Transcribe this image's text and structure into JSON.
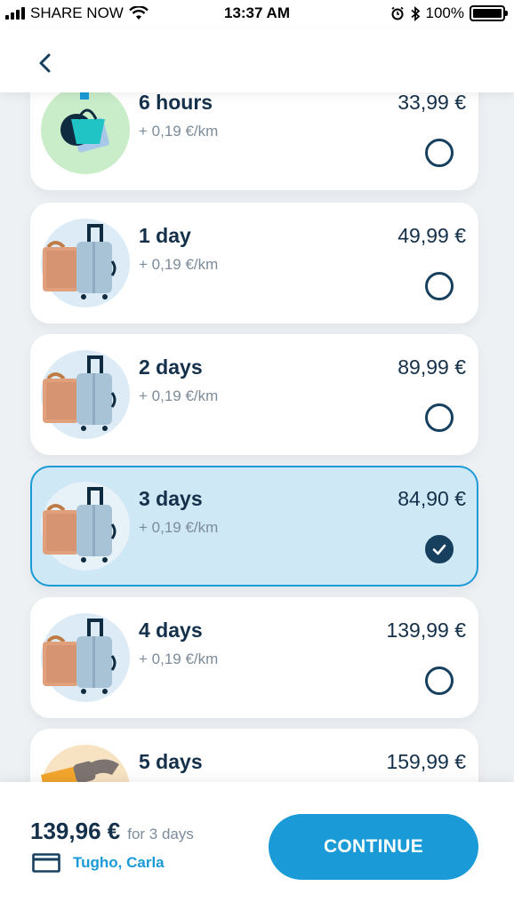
{
  "status_bar": {
    "carrier": "SHARE NOW",
    "time": "13:37 AM",
    "battery": "100%",
    "icons": [
      "signal-icon",
      "wifi-icon",
      "alarm-icon",
      "bluetooth-icon",
      "battery-icon"
    ]
  },
  "header": {
    "back_icon": "chevron-left-icon"
  },
  "options": [
    {
      "name": "6 hours",
      "rate": "+ 0,19 €/km",
      "price": "33,99 €",
      "selected": false,
      "illustration": "shopping-bag-icon"
    },
    {
      "name": "1 day",
      "rate": "+ 0,19 €/km",
      "price": "49,99 €",
      "selected": false,
      "illustration": "luggage-icon"
    },
    {
      "name": "2 days",
      "rate": "+ 0,19 €/km",
      "price": "89,99 €",
      "selected": false,
      "illustration": "luggage-icon"
    },
    {
      "name": "3 days",
      "rate": "+ 0,19 €/km",
      "price": "84,90 €",
      "selected": true,
      "illustration": "luggage-icon"
    },
    {
      "name": "4 days",
      "rate": "+ 0,19 €/km",
      "price": "139,99 €",
      "selected": false,
      "illustration": "luggage-icon"
    },
    {
      "name": "5 days",
      "rate": "",
      "price": "159,99 €",
      "selected": false,
      "illustration": "hand-watch-icon"
    }
  ],
  "footer": {
    "total": "139,96 €",
    "period": "for 3 days",
    "payer": "Tugho, Carla",
    "payer_icon": "card-icon",
    "continue_label": "CONTINUE"
  },
  "colors": {
    "accent": "#1a9bd7",
    "navy": "#14304a",
    "selected_bg": "#cfe8f5"
  }
}
